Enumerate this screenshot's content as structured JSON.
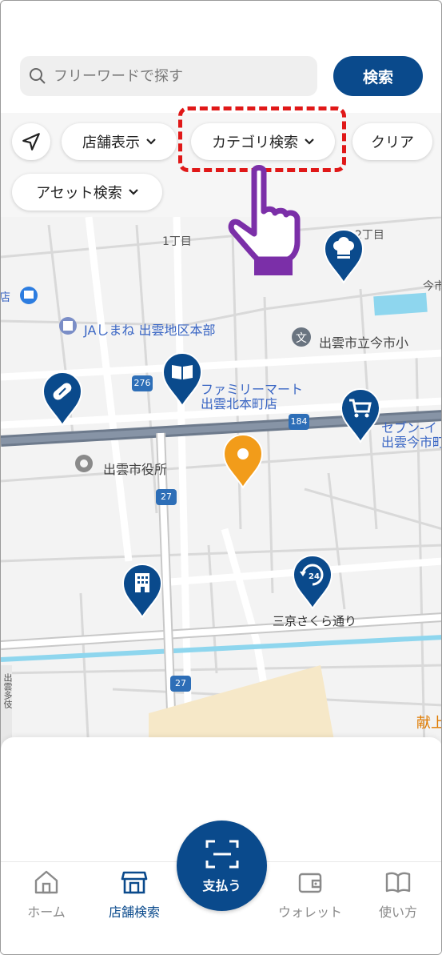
{
  "search": {
    "placeholder": "フリーワードで探す",
    "button_label": "検索"
  },
  "filters": {
    "store_display": "店舗表示",
    "category_search": "カテゴリ検索",
    "clear": "クリア",
    "asset_search": "アセット検索"
  },
  "map": {
    "labels": {
      "chome": "1丁目",
      "chome2": "2丁目",
      "ja": "JAしまね 出雲地区本部",
      "school": "出雲市立今市小",
      "familymart_1": "ファミリーマート",
      "familymart_2": "出雲北本町店",
      "city_hall": "出雲市役所",
      "seven_1": "セブン-イ",
      "seven_2": "出雲今市町",
      "street": "三京さくら通り",
      "ima": "今市",
      "store_edge": "店",
      "bottom_right": "献上",
      "left_vertical": "出雲多伎"
    },
    "route_numbers": {
      "r276": "276",
      "r184": "184",
      "r27a": "27",
      "r27b": "27"
    },
    "pins": [
      "chef-hat",
      "pill",
      "book",
      "cart",
      "selected-location",
      "building",
      "24-hours"
    ]
  },
  "tabbar": {
    "home": "ホーム",
    "store_search": "店舗検索",
    "pay": "支払う",
    "wallet": "ウォレット",
    "guide": "使い方"
  },
  "colors": {
    "primary": "#0a4a8c",
    "selected_pin": "#f29c1a",
    "highlight": "#e01818",
    "hand": "#7b2fa8"
  }
}
